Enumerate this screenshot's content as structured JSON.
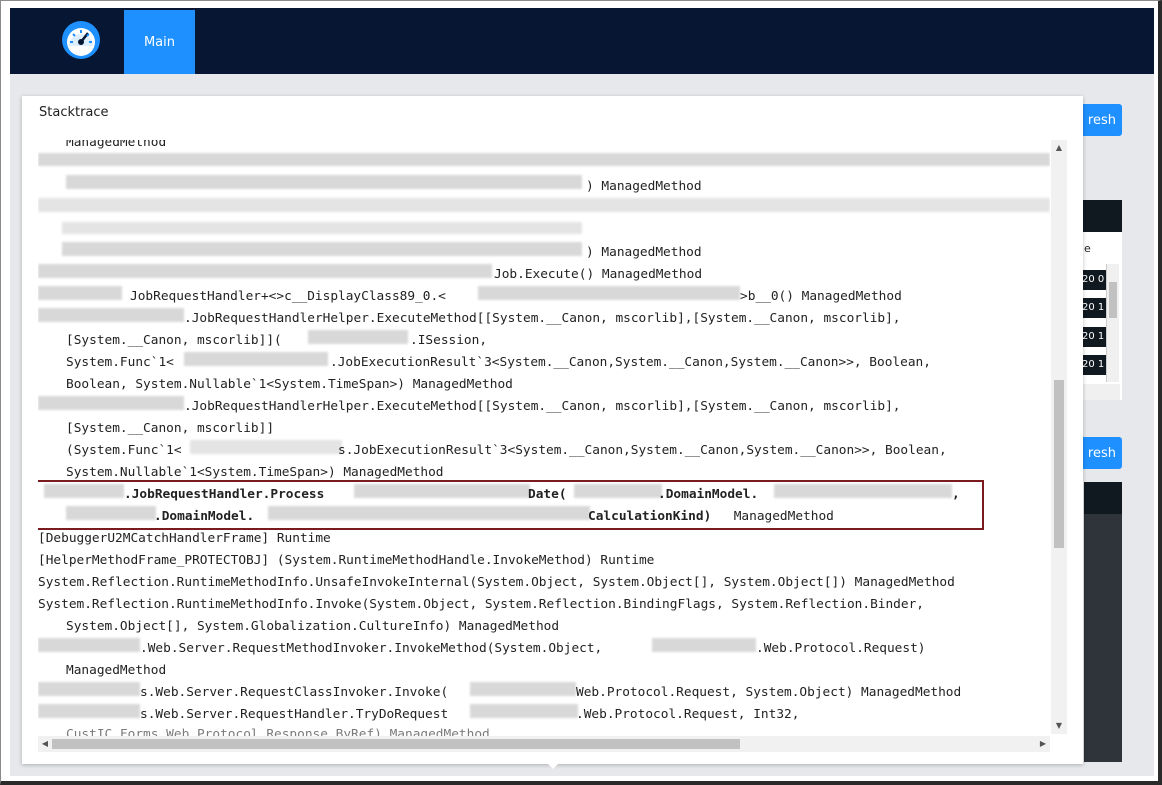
{
  "nav": {
    "tab_main": "Main",
    "logo_icon": "speedometer-icon"
  },
  "background": {
    "refresh_label": "resh",
    "column_header": "e",
    "rows": [
      "20 0",
      "20 1",
      "20 1",
      "20 1"
    ]
  },
  "modal": {
    "title": "Stacktrace"
  },
  "trace": {
    "l0": "ManagedMethod",
    "l1": ") ManagedMethod",
    "l2": ") ManagedMethod",
    "l3": "Job.Execute() ManagedMethod",
    "l4": "JobRequestHandler+<>c__DisplayClass89_0.<",
    "l4b": ">b__0() ManagedMethod",
    "l5": ".JobRequestHandlerHelper.ExecuteMethod[[System.__Canon, mscorlib],[System.__Canon, mscorlib],",
    "l6": "[System.__Canon, mscorlib]](",
    "l6b": ".ISession,",
    "l7": "System.Func`1<",
    "l7b": ".JobExecutionResult`3<System.__Canon,System.__Canon,System.__Canon>>, Boolean,",
    "l8": "Boolean, System.Nullable`1<System.TimeSpan>) ManagedMethod",
    "l9": ".JobRequestHandlerHelper.ExecuteMethod[[System.__Canon, mscorlib],[System.__Canon, mscorlib],",
    "l10": "[System.__Canon, mscorlib]]",
    "l11": "(System.Func`1<",
    "l11b": "s.JobExecutionResult`3<System.__Canon,System.__Canon,System.__Canon>>, Boolean,",
    "l12": "System.Nullable`1<System.TimeSpan>) ManagedMethod",
    "l13a": ".JobRequestHandler.Process",
    "l13b": "Date(",
    "l13c": ".DomainModel.",
    "l13d": ",",
    "l14a": ".DomainModel.",
    "l14b": "CalculationKind)",
    "l14c": " ManagedMethod",
    "l15": "[DebuggerU2MCatchHandlerFrame] Runtime",
    "l16": "[HelperMethodFrame_PROTECTOBJ] (System.RuntimeMethodHandle.InvokeMethod) Runtime",
    "l17": "System.Reflection.RuntimeMethodInfo.UnsafeInvokeInternal(System.Object, System.Object[], System.Object[]) ManagedMethod",
    "l18": "System.Reflection.RuntimeMethodInfo.Invoke(System.Object, System.Reflection.BindingFlags, System.Reflection.Binder,",
    "l19": "System.Object[], System.Globalization.CultureInfo) ManagedMethod",
    "l20": ".Web.Server.RequestMethodInvoker.InvokeMethod(System.Object,",
    "l20b": ".Web.Protocol.Request)",
    "l21": "ManagedMethod",
    "l22": "s.Web.Server.RequestClassInvoker.Invoke(",
    "l22b": "Web.Protocol.Request, System.Object) ManagedMethod",
    "l23": "s.Web.Server.RequestHandler.TryDoRequest",
    "l23b": ".Web.Protocol.Request, Int32,",
    "l24": "CustIC.Forms.Web.Protocol.Response ByRef) ManagedMethod"
  }
}
